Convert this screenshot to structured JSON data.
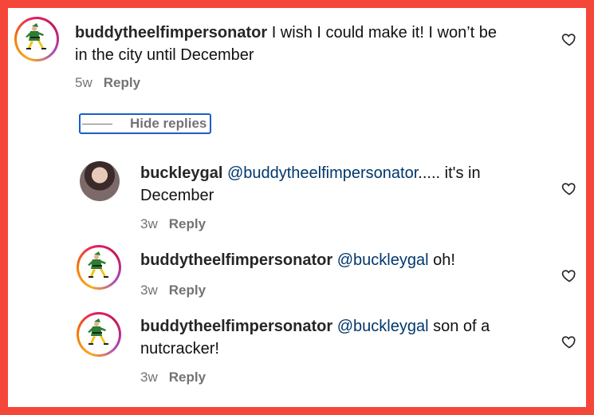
{
  "comments": [
    {
      "user": "buddytheelfimpersonator",
      "text_line1": " I wish I could make it! I won’t be",
      "text_line2": "in the city until December",
      "age": "5w",
      "reply_label": "Reply",
      "avatar_icon": "elf-avatar-icon",
      "like_icon": "heart-outline-icon"
    }
  ],
  "hide_replies_label": "Hide replies",
  "replies": [
    {
      "user": "buckleygal",
      "mention": "@buddytheelfimpersonator",
      "text": "..... it's in",
      "text_line2": "December",
      "age": "3w",
      "reply_label": "Reply"
    },
    {
      "user": "buddytheelfimpersonator",
      "mention": "@buckleygal",
      "text": " oh!",
      "age": "3w",
      "reply_label": "Reply"
    },
    {
      "user": "buddytheelfimpersonator",
      "mention": "@buckleygal",
      "text": " son of a",
      "text_line2": "nutcracker!",
      "age": "3w",
      "reply_label": "Reply"
    }
  ],
  "colors": {
    "frame_border": "#f4473a",
    "mention": "#00376b",
    "meta": "#737373",
    "focus_outline": "#1a5fc8"
  }
}
